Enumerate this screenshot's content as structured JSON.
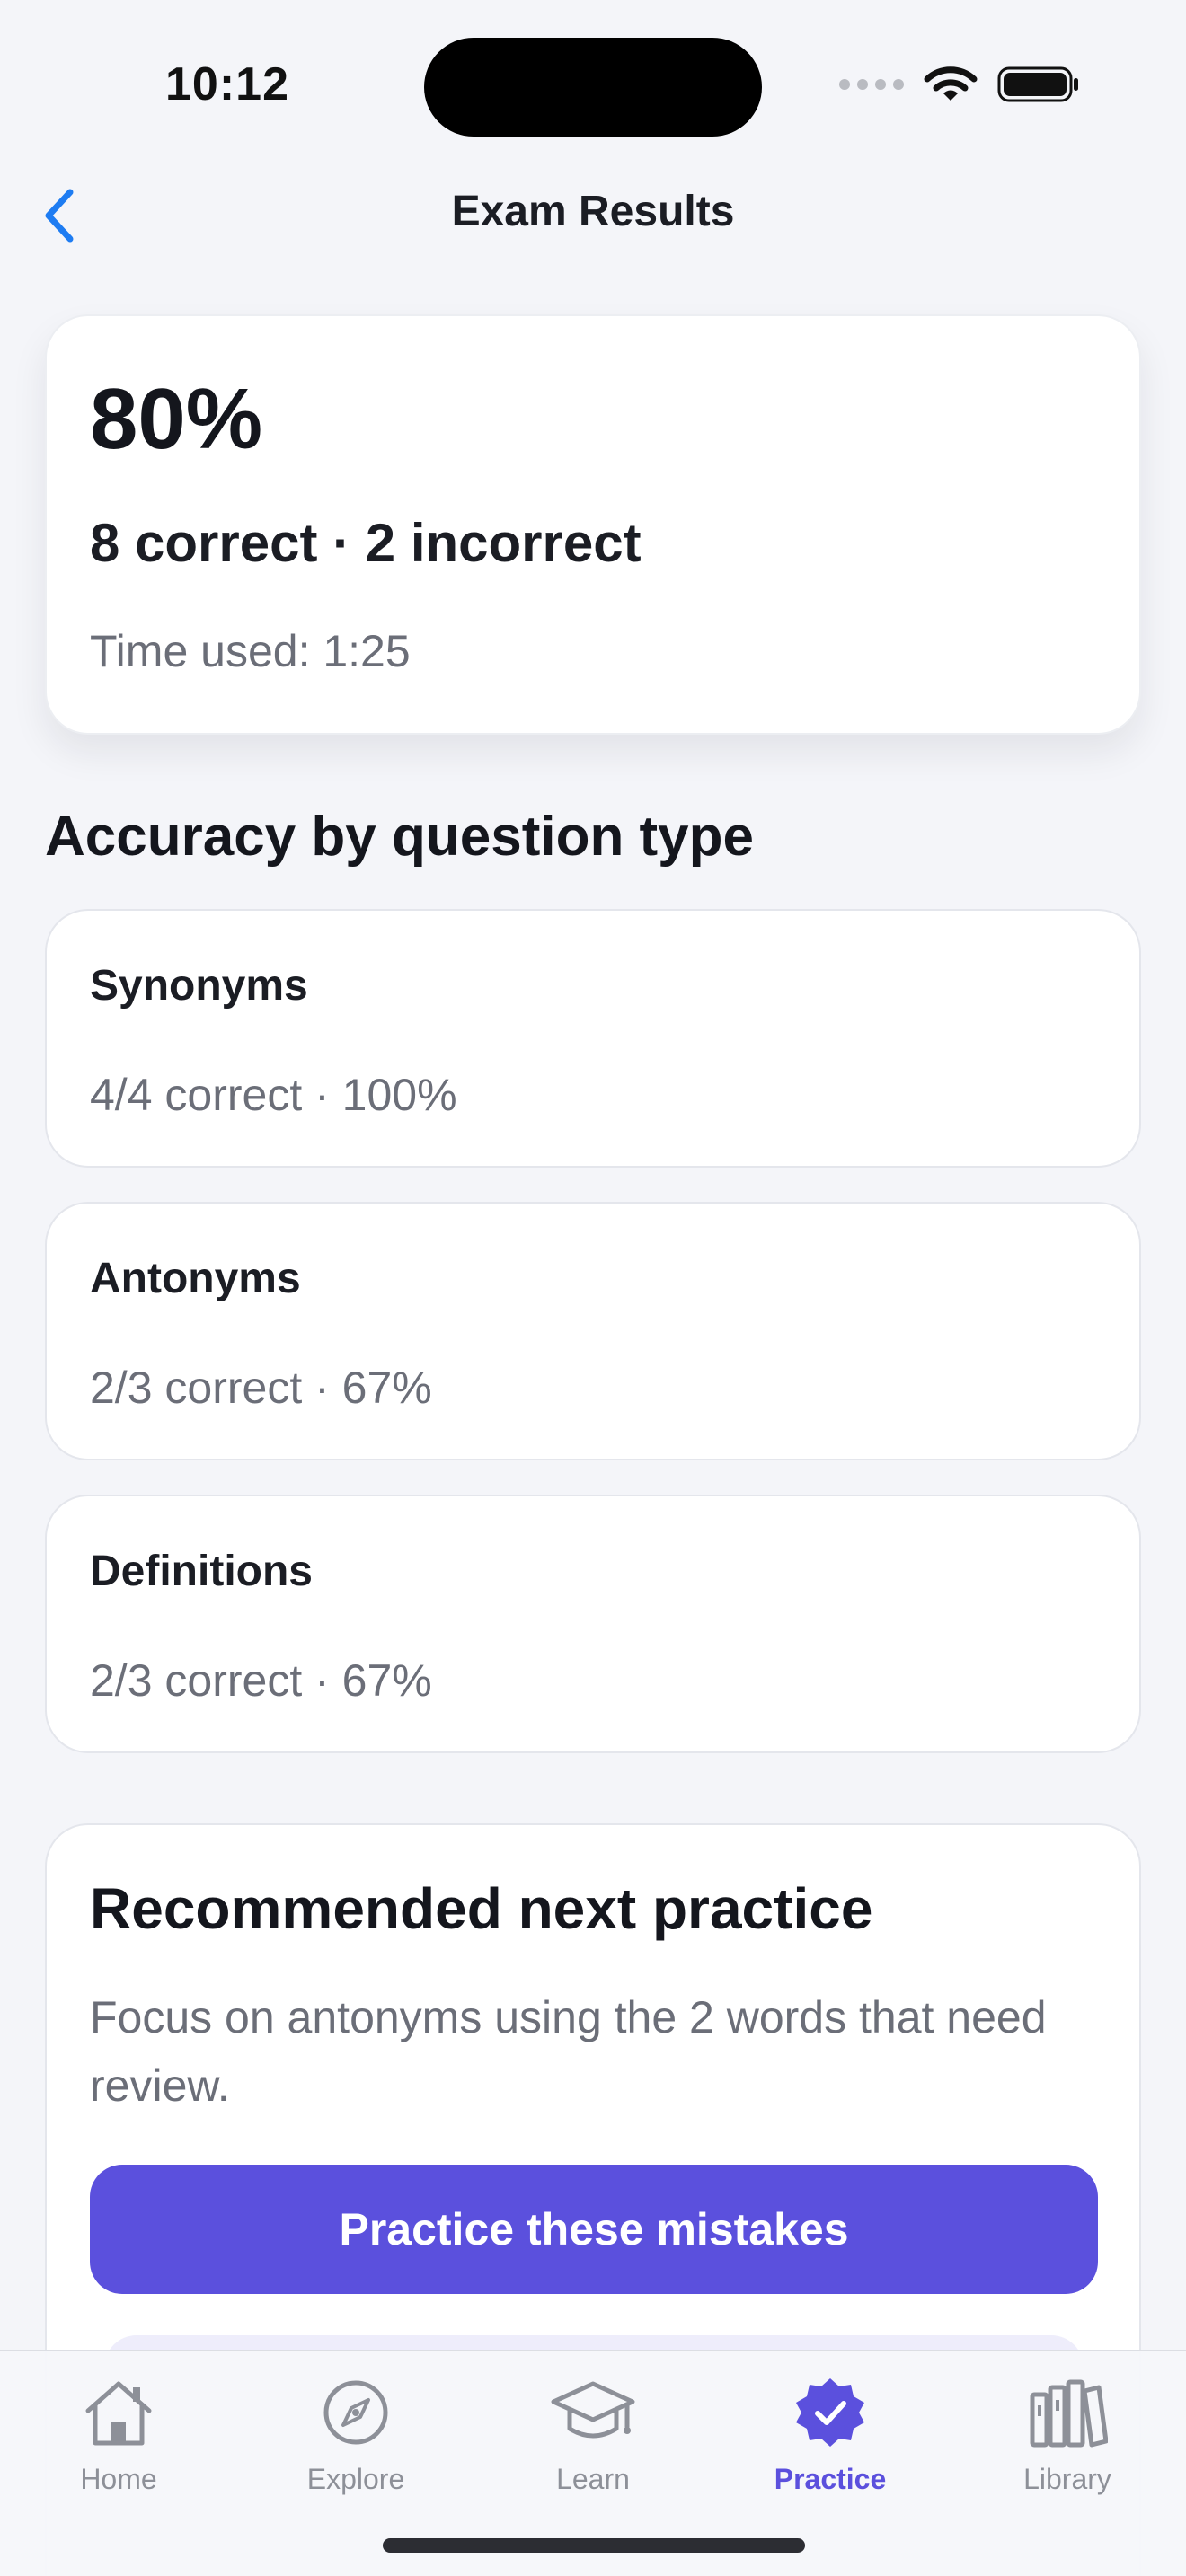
{
  "status_bar": {
    "time": "10:12",
    "icons": [
      "cellular-dots-icon",
      "wifi-icon",
      "battery-icon"
    ]
  },
  "nav": {
    "title": "Exam Results",
    "back_icon": "chevron-left-icon"
  },
  "score": {
    "percent": "80%",
    "summary": "8 correct · 2 incorrect",
    "time_used": "Time used: 1:25"
  },
  "accuracy": {
    "section_title": "Accuracy by question type",
    "items": [
      {
        "name": "Synonyms",
        "stat": "4/4 correct · 100%"
      },
      {
        "name": "Antonyms",
        "stat": "2/3 correct · 67%"
      },
      {
        "name": "Definitions",
        "stat": "2/3 correct · 67%"
      }
    ]
  },
  "recommendation": {
    "title": "Recommended next practice",
    "body": "Focus on antonyms using the 2 words that need review.",
    "button_label": "Practice these mistakes"
  },
  "tab_bar": {
    "items": [
      {
        "label": "Home",
        "icon": "home-icon",
        "active": false
      },
      {
        "label": "Explore",
        "icon": "compass-icon",
        "active": false
      },
      {
        "label": "Learn",
        "icon": "graduation-cap-icon",
        "active": false
      },
      {
        "label": "Practice",
        "icon": "checkmark-badge-icon",
        "active": true
      },
      {
        "label": "Library",
        "icon": "books-icon",
        "active": false
      }
    ]
  },
  "colors": {
    "accent": "#5B50DD",
    "back_chevron": "#1E7CF2",
    "background": "#F4F5F9",
    "card": "#FFFFFF",
    "muted_text": "#6B6E78",
    "inactive_tab": "#8D9098"
  }
}
